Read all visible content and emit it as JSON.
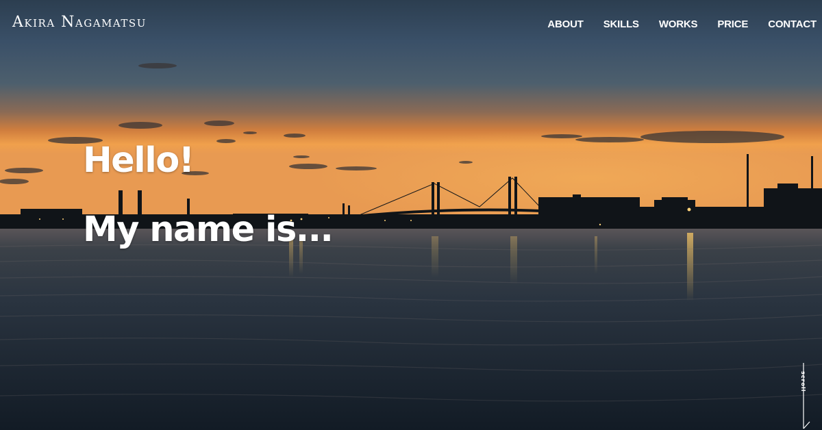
{
  "header": {
    "logo": "Akira Nagamatsu",
    "nav": [
      {
        "label": "ABOUT"
      },
      {
        "label": "SKILLS"
      },
      {
        "label": "WORKS"
      },
      {
        "label": "PRICE"
      },
      {
        "label": "CONTACT"
      }
    ]
  },
  "hero": {
    "line1": "Hello!",
    "line2": "My name is...",
    "scroll_label": "scroll"
  },
  "colors": {
    "text": "#ffffff",
    "sky_top": "#33495c",
    "horizon": "#f0a04c",
    "water": "#1c2a38"
  },
  "icons": {
    "scroll_indicator": "scroll-line-icon"
  }
}
